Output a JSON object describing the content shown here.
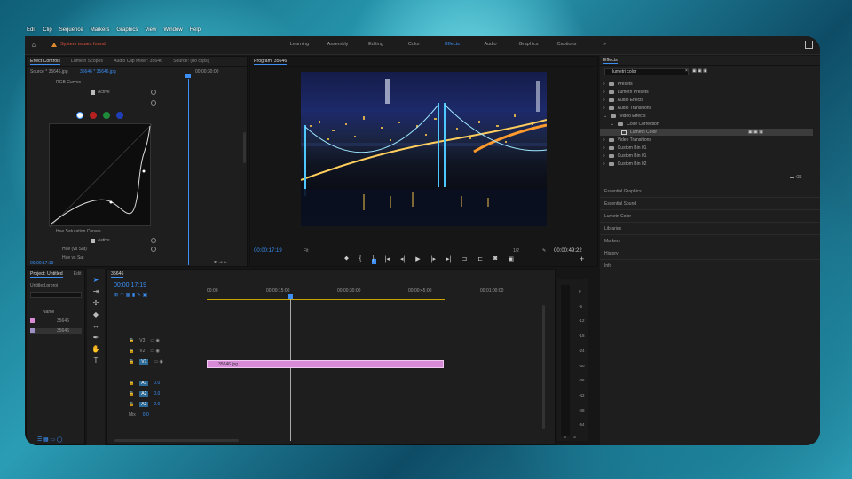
{
  "menubar": [
    "Edit",
    "Clip",
    "Sequence",
    "Markers",
    "Graphics",
    "View",
    "Window",
    "Help"
  ],
  "header": {
    "warning": "System issues found",
    "workspaces": [
      "Learning",
      "Assembly",
      "Editing",
      "Color",
      "Effects",
      "Audio",
      "Graphics",
      "Captions"
    ],
    "active_workspace": "Effects"
  },
  "effect_controls": {
    "tabs": [
      "Effect Controls",
      "Lumetri Scopes",
      "Audio Clip Mixer: 35646",
      "Source: (no clips)"
    ],
    "source": "Source * 35646.jpg",
    "sequence": "35646 * 35646.jpg",
    "timecode": "00:00:30:00",
    "section_rgb": "RGB Curves",
    "active_label": "Active",
    "section_hue": "Hue Saturation Curves",
    "active_label2": "Active",
    "hue_vs_sat": "Hue (vs Sat)",
    "hue_vs_sat2": "Hue vs Sat",
    "current_time": "00:00:17:19"
  },
  "program": {
    "title": "Program: 35646",
    "timecode": "00:00:17:19",
    "fit": "Fit",
    "resolution": "1/2",
    "duration": "00:00:49:22"
  },
  "project": {
    "tabs": [
      "Project: Untitled",
      "Edit"
    ],
    "file": "Untitled.prproj",
    "col_name": "Name",
    "items": [
      "35646",
      "35646"
    ]
  },
  "timeline": {
    "tab": "35646",
    "timecode": "00:00:17:19",
    "ruler": [
      "00:00",
      "00:00:15:00",
      "00:00:30:00",
      "00:00:45:00",
      "00:01:00:00"
    ],
    "video_tracks": [
      "V3",
      "V2",
      "V1"
    ],
    "audio_tracks": [
      "A1",
      "A2",
      "A3"
    ],
    "mix": "Mix",
    "clip": "35646.jpg",
    "audio_vals": [
      "0.0",
      "0.0",
      "0.0",
      "0.0"
    ]
  },
  "meter": {
    "labels": [
      "0",
      "-6",
      "-12",
      "-18",
      "-24",
      "-30",
      "-36",
      "-42",
      "-48",
      "-54",
      "dB"
    ],
    "bottom": [
      "S",
      "S"
    ]
  },
  "effects": {
    "title": "Effects",
    "search": "lumetri color",
    "tree": [
      "Presets",
      "Lumetri Presets",
      "Audio Effects",
      "Audio Transitions",
      "Video Effects",
      "Color Correction",
      "Lumetri Color",
      "Video Transitions",
      "Custom Bin 01",
      "Custom Bin 01",
      "Custom Bin 02"
    ],
    "sections": [
      "Essential Graphics",
      "Essential Sound",
      "Lumetri Color",
      "Libraries",
      "Markers",
      "History",
      "Info"
    ]
  },
  "colors": {
    "accent": "#3b8ff5",
    "clip": "#d98ad6",
    "warning": "#e0533f"
  }
}
